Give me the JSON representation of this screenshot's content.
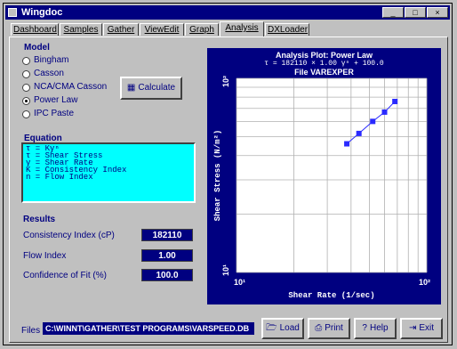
{
  "window": {
    "title": "Wingdoc",
    "controls": [
      "_",
      "□",
      "×"
    ]
  },
  "tabs": [
    {
      "label": "Dashboard",
      "active": false
    },
    {
      "label": "Samples",
      "active": false
    },
    {
      "label": "Gather",
      "active": false
    },
    {
      "label": "ViewEdit",
      "active": false
    },
    {
      "label": "Graph",
      "active": false
    },
    {
      "label": "Analysis",
      "active": true
    },
    {
      "label": "DXLoader",
      "active": false
    }
  ],
  "model": {
    "label": "Model",
    "options": [
      {
        "label": "Bingham",
        "checked": false
      },
      {
        "label": "Casson",
        "checked": false
      },
      {
        "label": "NCA/CMA Casson",
        "checked": false
      },
      {
        "label": "Power Law",
        "checked": true
      },
      {
        "label": "IPC Paste",
        "checked": false
      }
    ],
    "calculate_label": "Calculate"
  },
  "equation": {
    "label": "Equation",
    "lines": [
      "τ = Kγⁿ",
      "τ = Shear Stress",
      "γ = Shear Rate",
      "K = Consistency Index",
      "n = Flow Index"
    ]
  },
  "results": {
    "label": "Results",
    "rows": [
      {
        "label": "Consistency Index (cP)",
        "value": "182110"
      },
      {
        "label": "Flow Index",
        "value": "1.00"
      },
      {
        "label": "Confidence of Fit (%)",
        "value": "100.0"
      }
    ]
  },
  "plot": {
    "title": "Analysis Plot: Power Law",
    "equation": "τ = 182110 × 1.00 γⁿ + 100.0",
    "subtitle": "File VAREXPER",
    "xlabel": "Shear Rate (1/sec)",
    "ylabel": "Shear Stress (N/m²)",
    "x_ticks": [
      "10¹",
      "10²"
    ],
    "y_ticks": [
      "10¹",
      "10²"
    ],
    "colors": {
      "background": "#000080",
      "plot_area": "#ffffff",
      "grid": "#b0b0b0",
      "points": "#2a2aff"
    }
  },
  "chart_data": {
    "type": "scatter",
    "title": "Analysis Plot: Power Law",
    "xlabel": "Shear Rate (1/sec)",
    "ylabel": "Shear Stress (N/m²)",
    "xscale": "log",
    "yscale": "log",
    "xlim": [
      10,
      100
    ],
    "ylim": [
      10,
      100
    ],
    "grid": true,
    "series": [
      {
        "x": [
          38,
          44,
          52,
          60,
          68
        ],
        "y": [
          46,
          52,
          60,
          67,
          76
        ]
      }
    ]
  },
  "files": {
    "label": "Files",
    "path": "C:\\WINNT\\GATHER\\TEST PROGRAMS\\VARSPEED.DB"
  },
  "buttons": {
    "load": "Load",
    "print": "Print",
    "help": "Help",
    "exit": "Exit"
  },
  "icons": {
    "load": "folder-icon",
    "print": "printer-icon",
    "help": "help-icon",
    "exit": "exit-icon",
    "calculate": "calculator-icon"
  }
}
